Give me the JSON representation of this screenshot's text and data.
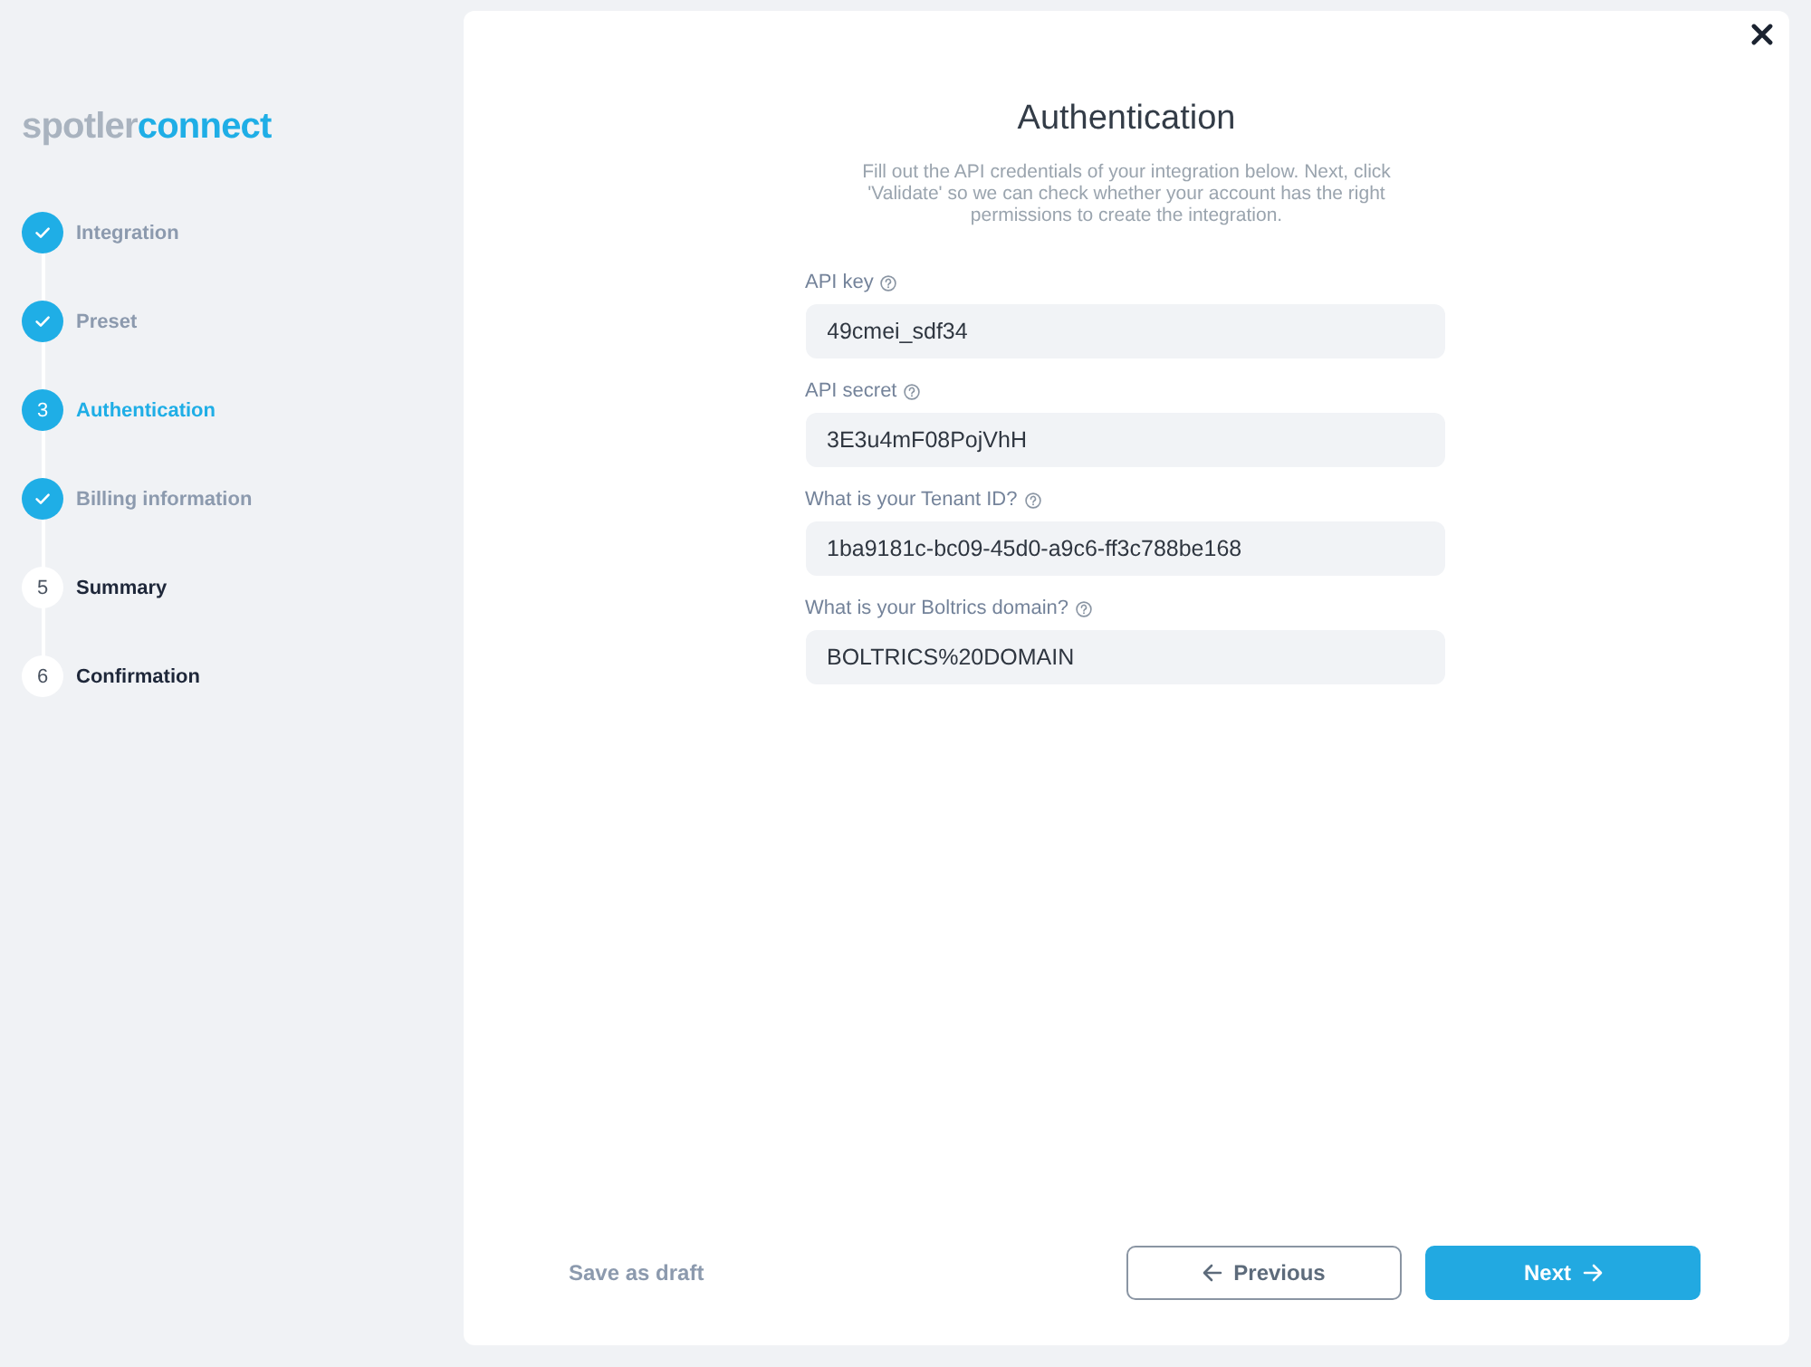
{
  "logo": {
    "prefix": "spotler",
    "suffix": "connect"
  },
  "steps": [
    {
      "label": "Integration",
      "completed": true,
      "selected": false
    },
    {
      "label": "Preset",
      "completed": true,
      "selected": false
    },
    {
      "label": "Authentication",
      "number": "3",
      "completed": false,
      "selected": true
    },
    {
      "label": "Billing information",
      "completed": true,
      "selected": false
    },
    {
      "label": "Summary",
      "number": "5",
      "completed": false,
      "selected": false
    },
    {
      "label": "Confirmation",
      "number": "6",
      "completed": false,
      "selected": false
    }
  ],
  "dialog": {
    "title": "Authentication",
    "description": "Fill out the API credentials of your integration below. Next, click 'Validate' so we can check whether your account has the right permissions to create the integration.",
    "fields": [
      {
        "label": "API key",
        "value": "49cmei_sdf34"
      },
      {
        "label": "API secret",
        "value": "3E3u4mF08PojVhH"
      },
      {
        "label": "What is your Tenant ID?",
        "value": "1ba9181c-bc09-45d0-a9c6-ff3c788be168"
      },
      {
        "label": "What is your Boltrics domain?",
        "value": "BOLTRICS%20DOMAIN"
      }
    ],
    "save_draft": "Save as draft",
    "previous_button": "Previous",
    "next_button": "Next"
  }
}
